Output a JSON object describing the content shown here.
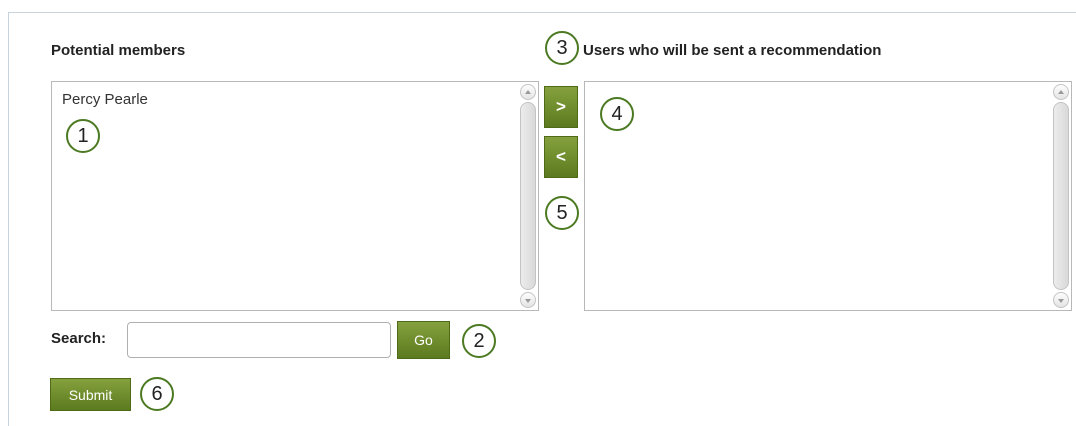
{
  "left_panel": {
    "heading": "Potential members",
    "items": [
      "Percy Pearle"
    ]
  },
  "right_panel": {
    "heading": "Users who will be sent a recommendation",
    "items": []
  },
  "transfer": {
    "add_label": ">",
    "remove_label": "<"
  },
  "search": {
    "label": "Search:",
    "value": "",
    "placeholder": "",
    "go_label": "Go"
  },
  "submit_label": "Submit",
  "callouts": [
    "1",
    "2",
    "3",
    "4",
    "5",
    "6"
  ],
  "colors": {
    "button_green": "#6b8a2a",
    "callout_border": "#4c7a22"
  }
}
